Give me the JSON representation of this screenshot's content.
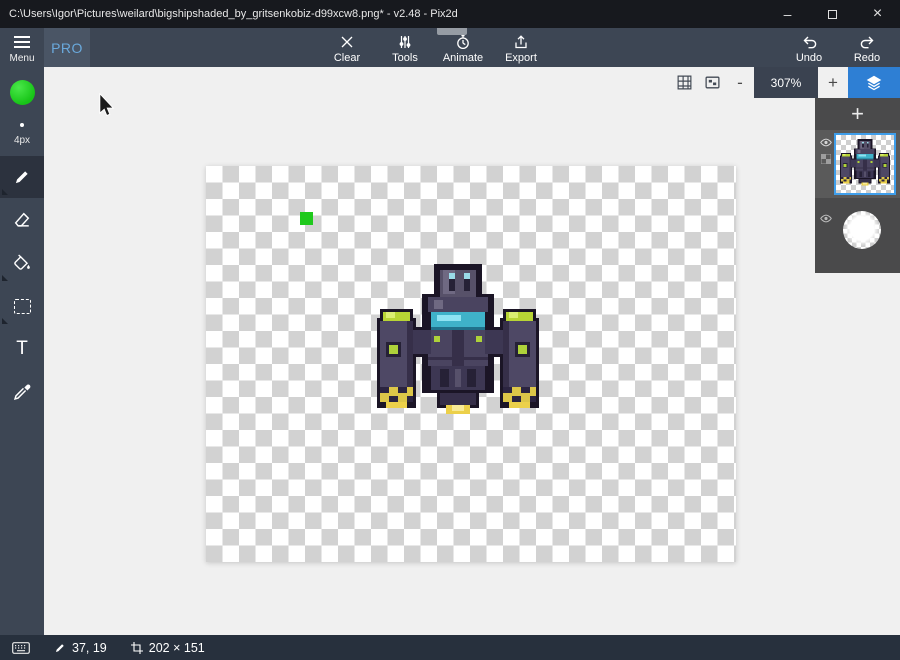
{
  "titlebar": {
    "title": "C:\\Users\\Igor\\Pictures\\weilard\\bigshipshaded_by_gritsenkobiz-d99xcw8.png* - v2.48 - Pix2d",
    "minimize_glyph": "–",
    "close_glyph": "×"
  },
  "topbar": {
    "pro_label": "PRO",
    "actions": [
      {
        "id": "clear",
        "label": "Clear"
      },
      {
        "id": "tools",
        "label": "Tools"
      },
      {
        "id": "animate",
        "label": "Animate"
      },
      {
        "id": "export",
        "label": "Export"
      }
    ],
    "history": [
      {
        "id": "undo",
        "label": "Undo"
      },
      {
        "id": "redo",
        "label": "Redo"
      }
    ]
  },
  "view_controls": {
    "zoom_out_glyph": "-",
    "zoom_level": "307%",
    "zoom_in_glyph": "+"
  },
  "tool_sidebar": {
    "menu_label": "Menu",
    "brush_size_label": "4px",
    "text_tool_glyph": "T",
    "primary_color": "#23d523",
    "tools": [
      "pencil",
      "eraser",
      "fill",
      "select",
      "text",
      "eyedropper"
    ]
  },
  "layers_panel": {
    "add_layer_glyph": "+"
  },
  "canvas": {
    "zoom": "307%",
    "painted_pixel_color": "#1fc91c"
  },
  "status_bar": {
    "cursor_position": "37, 19",
    "document_size": "202 × 151"
  },
  "colors": {
    "accent_blue": "#2e7fd4",
    "chrome_dark": "#3d4654",
    "titlebar_bg": "#17191e",
    "canvas_bg": "#f0f0f0",
    "layer_selection_border": "#3f9eea"
  }
}
